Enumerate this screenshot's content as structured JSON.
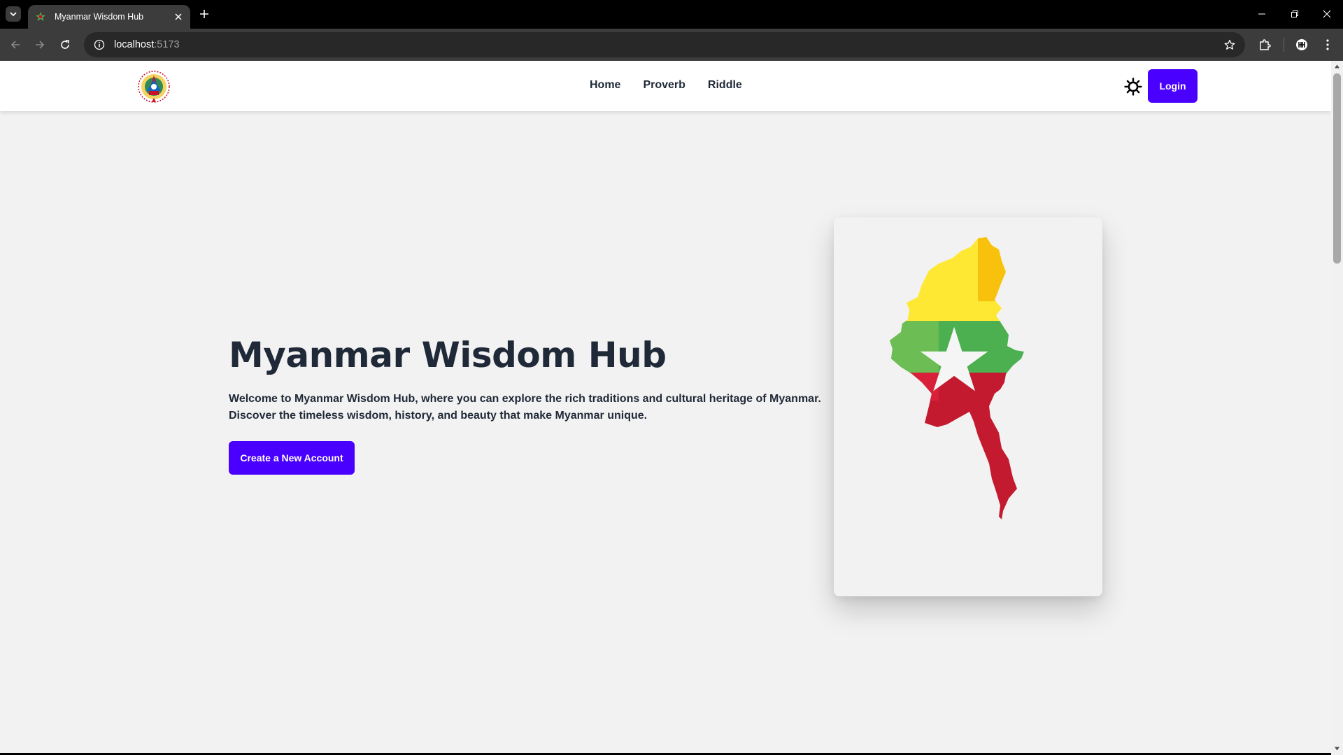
{
  "browser": {
    "tab_title": "Myanmar Wisdom Hub",
    "url_host": "localhost",
    "url_port": ":5173"
  },
  "site": {
    "nav": {
      "links": [
        {
          "label": "Home"
        },
        {
          "label": "Proverb"
        },
        {
          "label": "Riddle"
        }
      ],
      "login_label": "Login",
      "theme_icon": "sun-icon"
    },
    "hero": {
      "title": "Myanmar Wisdom Hub",
      "text": "Welcome to Myanmar Wisdom Hub, where you can explore the rich traditions and cultural heritage of Myanmar. Discover the timeless wisdom, history, and beauty that make Myanmar unique.",
      "cta_label": "Create a New Account"
    }
  },
  "colors": {
    "primary": "#4a00ff",
    "flag_yellow": "#fee833",
    "flag_green": "#4caf50",
    "flag_red": "#c8102e",
    "page_bg": "#f2f2f2",
    "text": "#1f2937"
  }
}
